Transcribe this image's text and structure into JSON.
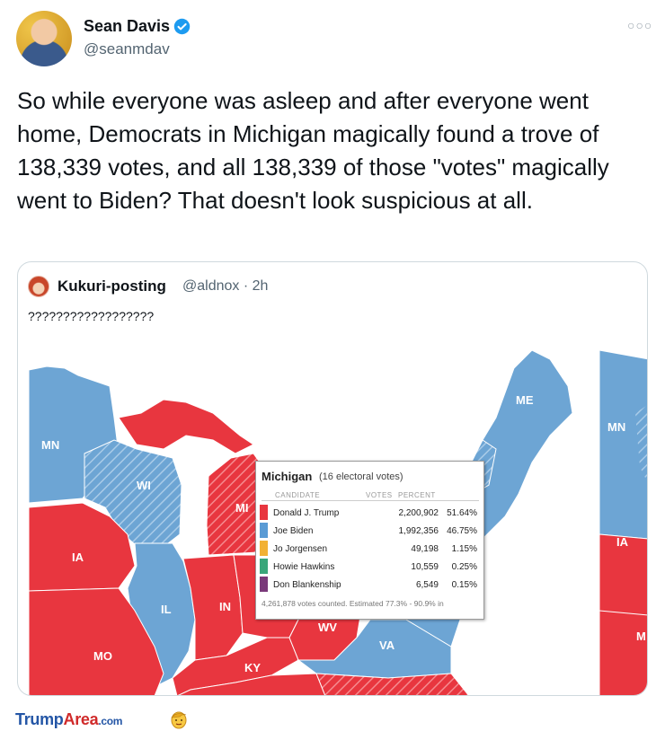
{
  "tweet": {
    "author_name": "Sean Davis",
    "handle": "@seanmdav",
    "text": "So while everyone was asleep and after everyone went home, Democrats in Michigan magically found a trove of 138,339 votes, and all 138,339 of those \"votes\" magically went to Biden? That doesn't look suspicious at all.",
    "more_icon": "more-icon",
    "verified_icon": "verified-badge-icon"
  },
  "quote": {
    "author_name": "Kukuri-posting",
    "handle": "@aldnox",
    "time": "· 2h",
    "text": "??????????????????"
  },
  "map": {
    "colors": {
      "red": "#e8363f",
      "blue": "#6da5d4",
      "water": "#ffffff"
    },
    "state_labels": [
      "MN",
      "WI",
      "MI",
      "IA",
      "IL",
      "IN",
      "MO",
      "KY",
      "WV",
      "VA",
      "ME",
      "MN",
      "IA",
      "M"
    ]
  },
  "results": {
    "state": "Michigan",
    "subtitle": "(16 electoral votes)",
    "headers": {
      "candidate": "CANDIDATE",
      "votes": "VOTES",
      "percent": "PERCENT"
    },
    "rows": [
      {
        "name": "Donald J. Trump",
        "votes": "2,200,902",
        "percent": "51.64%",
        "color": "#e8363f"
      },
      {
        "name": "Joe Biden",
        "votes": "1,992,356",
        "percent": "46.75%",
        "color": "#5a9bd5"
      },
      {
        "name": "Jo Jorgensen",
        "votes": "49,198",
        "percent": "1.15%",
        "color": "#f2b134"
      },
      {
        "name": "Howie Hawkins",
        "votes": "10,559",
        "percent": "0.25%",
        "color": "#3aa67a"
      },
      {
        "name": "Don Blankenship",
        "votes": "6,549",
        "percent": "0.15%",
        "color": "#7a3a7a"
      }
    ],
    "footer": "4,261,878 votes counted. Estimated 77.3% - 90.9% in"
  },
  "footer": {
    "logo_trump": "Trump",
    "logo_area": "Area",
    "logo_com": ".com"
  }
}
